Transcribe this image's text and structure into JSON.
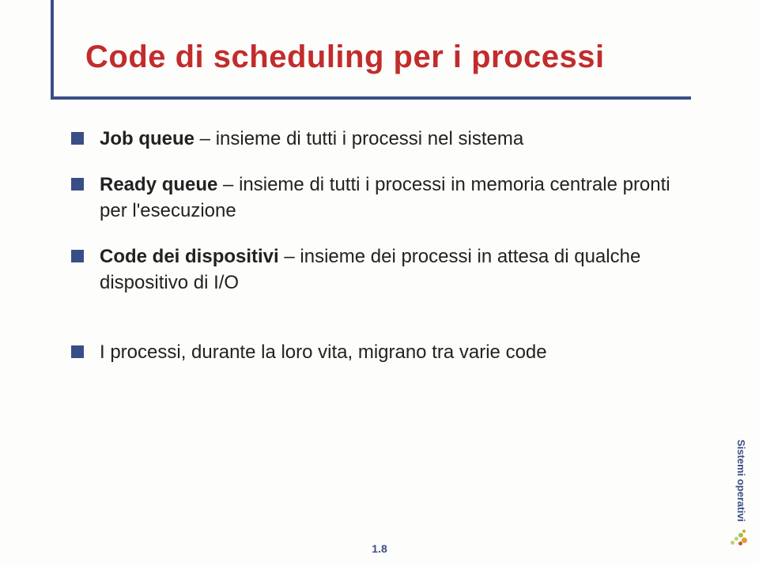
{
  "title": "Code di scheduling per i processi",
  "items": [
    {
      "bold": "Job queue",
      "rest": " – insieme di tutti i processi nel sistema"
    },
    {
      "bold": "Ready queue",
      "rest": " – insieme di tutti i processi in memoria centrale pronti per l'esecuzione"
    },
    {
      "bold": "Code dei dispositivi",
      "rest": " – insieme dei processi in attesa di qualche dispositivo di I/O"
    },
    {
      "bold": "",
      "rest": "I processi, durante la loro vita, migrano tra varie code"
    }
  ],
  "footer": "1.8",
  "side_label": "Sistemi operativi"
}
